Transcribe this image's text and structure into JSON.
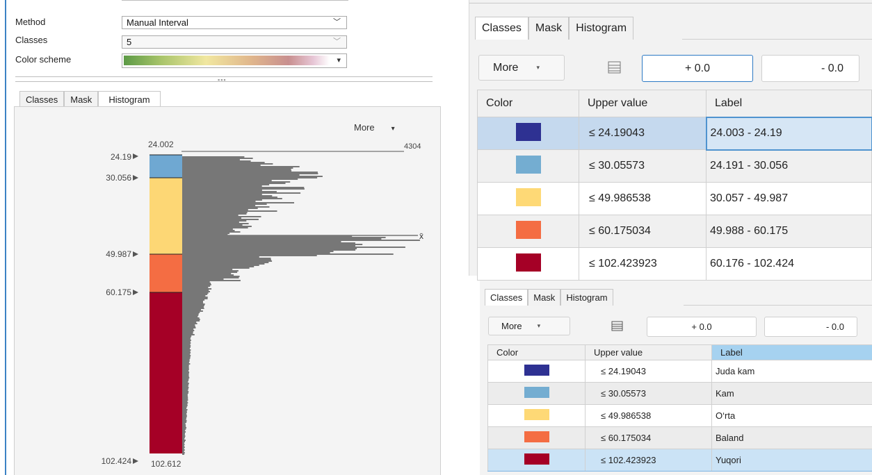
{
  "left_panel": {
    "method_label": "Method",
    "method_value": "Manual Interval",
    "classes_label": "Classes",
    "classes_value": "5",
    "color_scheme_label": "Color scheme",
    "tabs": [
      {
        "label": "Classes",
        "active": false
      },
      {
        "label": "Mask",
        "active": false
      },
      {
        "label": "Histogram",
        "active": true
      }
    ],
    "more_label": "More",
    "histogram": {
      "data_min": "24.002",
      "data_max": "102.612",
      "max_count": "4304",
      "mean_symbol": "x̄",
      "break_labels": [
        "24.19",
        "30.056",
        "49.987",
        "60.175",
        "102.424"
      ],
      "colors": [
        "#6fa8d2",
        "#fdd775",
        "#f46d43",
        "#a50026"
      ],
      "bar_color": "#777777"
    }
  },
  "top_right": {
    "tabs": [
      {
        "label": "Classes",
        "active": true
      },
      {
        "label": "Mask",
        "active": false
      },
      {
        "label": "Histogram",
        "active": false
      }
    ],
    "more_label": "More",
    "plus_value": "+ 0.0",
    "minus_value": "- 0.0",
    "columns": [
      "Color",
      "Upper value",
      "Label"
    ],
    "rows": [
      {
        "color": "#2e3192",
        "upper": "≤  24.19043",
        "label": "24.003 - 24.19"
      },
      {
        "color": "#74add1",
        "upper": "≤  30.05573",
        "label": "24.191 - 30.056"
      },
      {
        "color": "#fed976",
        "upper": "≤  49.986538",
        "label": "30.057 - 49.987"
      },
      {
        "color": "#f46d43",
        "upper": "≤  60.175034",
        "label": "49.988 - 60.175"
      },
      {
        "color": "#a50026",
        "upper": "≤  102.423923",
        "label": "60.176 - 102.424"
      }
    ]
  },
  "bottom_right": {
    "tabs": [
      {
        "label": "Classes",
        "active": true
      },
      {
        "label": "Mask",
        "active": false
      },
      {
        "label": "Histogram",
        "active": false
      }
    ],
    "more_label": "More",
    "plus_value": "+ 0.0",
    "minus_value": "- 0.0",
    "columns": [
      "Color",
      "Upper value",
      "Label"
    ],
    "rows": [
      {
        "color": "#2e3192",
        "upper": "≤  24.19043",
        "label": "Juda kam"
      },
      {
        "color": "#74add1",
        "upper": "≤  30.05573",
        "label": "Kam"
      },
      {
        "color": "#fed976",
        "upper": "≤  49.986538",
        "label": "O‘rta"
      },
      {
        "color": "#f46d43",
        "upper": "≤  60.175034",
        "label": "Baland"
      },
      {
        "color": "#a50026",
        "upper": "≤  102.423923",
        "label": "Yuqori"
      }
    ]
  }
}
